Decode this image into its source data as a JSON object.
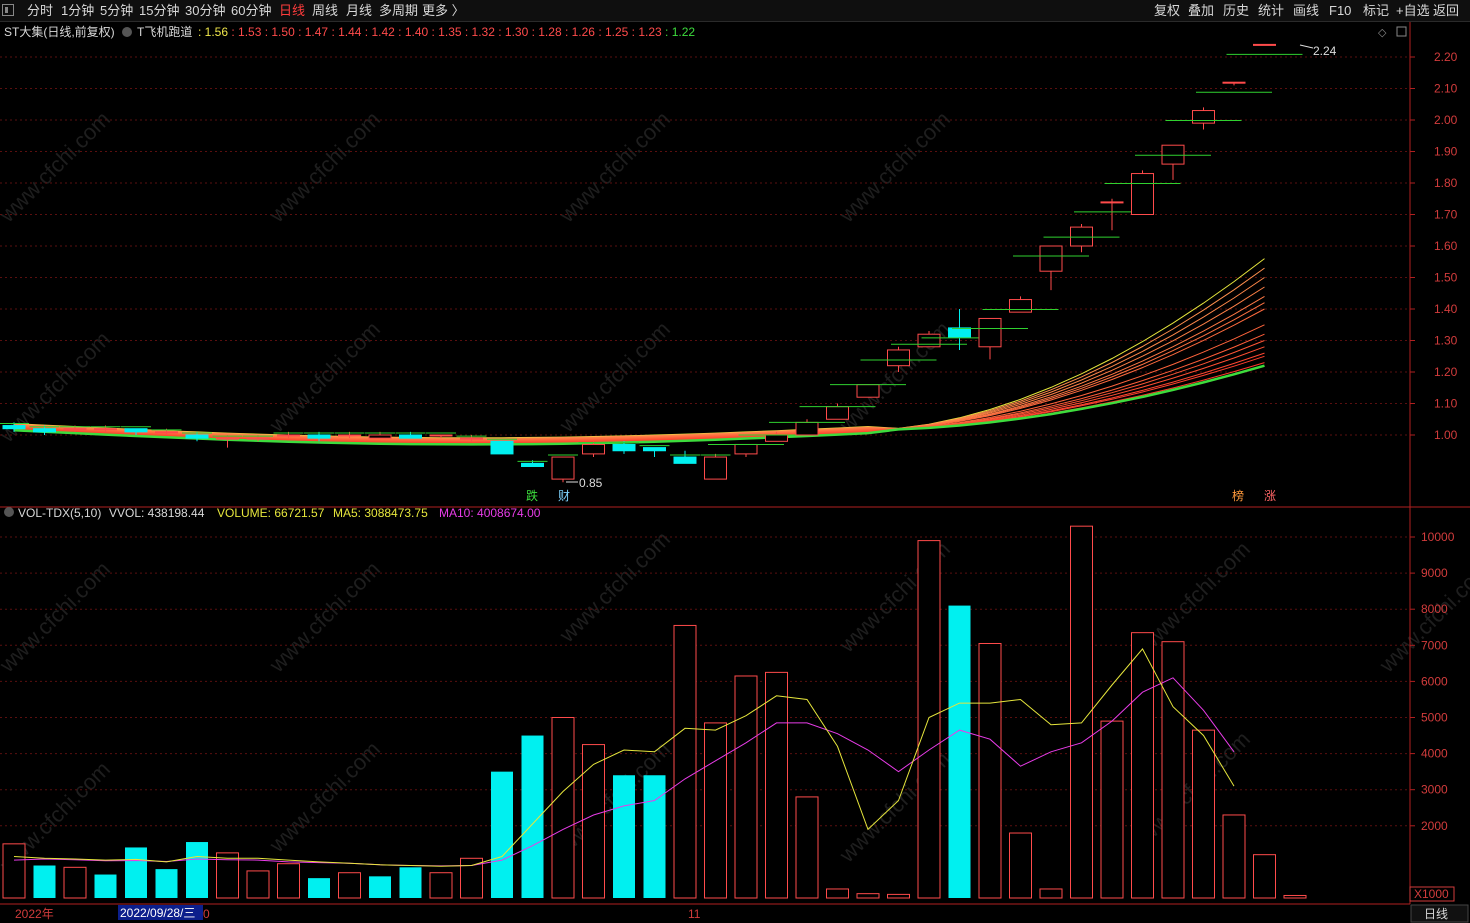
{
  "toolbar": {
    "periods": [
      "分时",
      "1分钟",
      "5分钟",
      "15分钟",
      "30分钟",
      "60分钟",
      "日线",
      "周线",
      "月线",
      "多周期",
      "更多 〉"
    ],
    "active_period": "日线",
    "right_buttons": [
      "复权",
      "叠加",
      "历史",
      "统计",
      "画线",
      "F10",
      "标记",
      "+自选",
      "返回"
    ]
  },
  "main_panel": {
    "title": "ST大集(日线,前复权)",
    "indicator_name": "T飞机跑道",
    "indicator_values": [
      {
        "text": ": 1.56",
        "color": "#f0e64a"
      },
      {
        "text": ": 1.53",
        "color": "#ff4b4b"
      },
      {
        "text": ": 1.50",
        "color": "#ff4b4b"
      },
      {
        "text": ": 1.47",
        "color": "#ff4b4b"
      },
      {
        "text": ": 1.44",
        "color": "#ff4b4b"
      },
      {
        "text": ": 1.42",
        "color": "#ff4b4b"
      },
      {
        "text": ": 1.40",
        "color": "#ff4b4b"
      },
      {
        "text": ": 1.35",
        "color": "#ff4b4b"
      },
      {
        "text": ": 1.32",
        "color": "#ff4b4b"
      },
      {
        "text": ": 1.30",
        "color": "#ff4b4b"
      },
      {
        "text": ": 1.28",
        "color": "#ff4b4b"
      },
      {
        "text": ": 1.26",
        "color": "#ff4b4b"
      },
      {
        "text": ": 1.25",
        "color": "#ff4b4b"
      },
      {
        "text": ": 1.23",
        "color": "#ff4b4b"
      },
      {
        "text": ": 1.22",
        "color": "#3ddc3d"
      }
    ],
    "y_ticks": [
      "2.20",
      "2.10",
      "2.00",
      "1.90",
      "1.80",
      "1.70",
      "1.60",
      "1.50",
      "1.40",
      "1.30",
      "1.20",
      "1.10",
      "1.00"
    ],
    "high_label": "2.24",
    "low_label": "0.85",
    "badges": [
      {
        "text": "跌",
        "color": "#3ddc3d"
      },
      {
        "text": "财",
        "color": "#7fd4ff"
      },
      {
        "text": "榜",
        "color": "#ff9a3c"
      },
      {
        "text": "涨",
        "color": "#ff6666"
      }
    ]
  },
  "volume_panel": {
    "title": "VOL-TDX(5,10)",
    "vvol": "VVOL: 438198.44",
    "volume": "VOLUME: 66721.57",
    "ma5": "MA5: 3088473.75",
    "ma10": "MA10: 4008674.00",
    "y_ticks": [
      "10000",
      "9000",
      "8000",
      "7000",
      "6000",
      "5000",
      "4000",
      "3000",
      "2000"
    ],
    "unit": "X1000"
  },
  "bottom_bar": {
    "year_label": "2022年",
    "cursor_date": "2022/09/28/三",
    "cursor_suffix": "0",
    "month_label": "11",
    "period_label": "日线"
  },
  "watermark": "www.cfchi.com",
  "colors": {
    "up": "#ff4b4b",
    "down": "#00f0f0",
    "ma5": "#e6e63c",
    "ma10": "#e83ce8",
    "grid": "#5a0f0f",
    "axis_text": "#d23c3c"
  },
  "chart_data": {
    "type": "candlestick",
    "price_range": [
      0.85,
      2.24
    ],
    "candles": [
      {
        "o": 1.03,
        "c": 1.02,
        "h": 1.04,
        "l": 1.01
      },
      {
        "o": 1.02,
        "c": 1.01,
        "h": 1.03,
        "l": 1.0
      },
      {
        "o": 1.02,
        "c": 1.02,
        "h": 1.03,
        "l": 1.01
      },
      {
        "o": 1.02,
        "c": 1.02,
        "h": 1.03,
        "l": 1.01
      },
      {
        "o": 1.02,
        "c": 1.01,
        "h": 1.02,
        "l": 1.0
      },
      {
        "o": 1.01,
        "c": 1.01,
        "h": 1.02,
        "l": 1.0
      },
      {
        "o": 1.0,
        "c": 0.99,
        "h": 1.01,
        "l": 0.98
      },
      {
        "o": 0.99,
        "c": 0.99,
        "h": 1.0,
        "l": 0.96
      },
      {
        "o": 0.99,
        "c": 0.99,
        "h": 1.0,
        "l": 0.98
      },
      {
        "o": 1.0,
        "c": 1.0,
        "h": 1.01,
        "l": 0.99
      },
      {
        "o": 1.0,
        "c": 0.99,
        "h": 1.01,
        "l": 0.98
      },
      {
        "o": 1.0,
        "c": 1.0,
        "h": 1.01,
        "l": 0.99
      },
      {
        "o": 0.99,
        "c": 1.0,
        "h": 1.01,
        "l": 0.99
      },
      {
        "o": 1.0,
        "c": 0.99,
        "h": 1.01,
        "l": 0.99
      },
      {
        "o": 1.0,
        "c": 1.0,
        "h": 1.0,
        "l": 0.99
      },
      {
        "o": 0.99,
        "c": 0.99,
        "h": 1.0,
        "l": 0.98
      },
      {
        "o": 0.98,
        "c": 0.94,
        "h": 0.98,
        "l": 0.94
      },
      {
        "o": 0.91,
        "c": 0.9,
        "h": 0.92,
        "l": 0.9
      },
      {
        "o": 0.86,
        "c": 0.93,
        "h": 0.93,
        "l": 0.85
      },
      {
        "o": 0.94,
        "c": 0.97,
        "h": 0.98,
        "l": 0.93
      },
      {
        "o": 0.97,
        "c": 0.95,
        "h": 0.98,
        "l": 0.94
      },
      {
        "o": 0.96,
        "c": 0.95,
        "h": 0.96,
        "l": 0.93
      },
      {
        "o": 0.93,
        "c": 0.91,
        "h": 0.95,
        "l": 0.91
      },
      {
        "o": 0.86,
        "c": 0.93,
        "h": 0.94,
        "l": 0.86
      },
      {
        "o": 0.94,
        "c": 0.97,
        "h": 0.97,
        "l": 0.93
      },
      {
        "o": 0.98,
        "c": 1.0,
        "h": 1.01,
        "l": 0.98
      },
      {
        "o": 1.0,
        "c": 1.04,
        "h": 1.05,
        "l": 1.0
      },
      {
        "o": 1.05,
        "c": 1.09,
        "h": 1.1,
        "l": 1.05
      },
      {
        "o": 1.12,
        "c": 1.16,
        "h": 1.16,
        "l": 1.12
      },
      {
        "o": 1.22,
        "c": 1.27,
        "h": 1.28,
        "l": 1.2
      },
      {
        "o": 1.28,
        "c": 1.32,
        "h": 1.33,
        "l": 1.28
      },
      {
        "o": 1.34,
        "c": 1.31,
        "h": 1.4,
        "l": 1.27
      },
      {
        "o": 1.28,
        "c": 1.37,
        "h": 1.37,
        "l": 1.24
      },
      {
        "o": 1.39,
        "c": 1.43,
        "h": 1.44,
        "l": 1.39
      },
      {
        "o": 1.52,
        "c": 1.6,
        "h": 1.6,
        "l": 1.46
      },
      {
        "o": 1.6,
        "c": 1.66,
        "h": 1.67,
        "l": 1.58
      },
      {
        "o": 1.74,
        "c": 1.74,
        "h": 1.75,
        "l": 1.65
      },
      {
        "o": 1.7,
        "c": 1.83,
        "h": 1.84,
        "l": 1.7
      },
      {
        "o": 1.86,
        "c": 1.92,
        "h": 1.92,
        "l": 1.81
      },
      {
        "o": 1.99,
        "c": 2.03,
        "h": 2.04,
        "l": 1.97
      },
      {
        "o": 2.12,
        "c": 2.12,
        "h": 2.12,
        "l": 2.11
      },
      {
        "o": 2.24,
        "c": 2.24,
        "h": 2.24,
        "l": 2.24
      }
    ],
    "runway_lines_end": [
      1.56,
      1.53,
      1.5,
      1.47,
      1.44,
      1.42,
      1.4,
      1.35,
      1.32,
      1.3,
      1.28,
      1.26,
      1.25,
      1.23,
      1.22
    ],
    "volume_unit": "X1000",
    "volume_range": [
      0,
      10500
    ],
    "volume": [
      {
        "v": 1500,
        "up": true
      },
      {
        "v": 900,
        "up": false
      },
      {
        "v": 850,
        "up": true
      },
      {
        "v": 650,
        "up": false
      },
      {
        "v": 1400,
        "up": false
      },
      {
        "v": 800,
        "up": false
      },
      {
        "v": 1550,
        "up": false
      },
      {
        "v": 1250,
        "up": true
      },
      {
        "v": 750,
        "up": true
      },
      {
        "v": 950,
        "up": true
      },
      {
        "v": 550,
        "up": false
      },
      {
        "v": 700,
        "up": true
      },
      {
        "v": 600,
        "up": false
      },
      {
        "v": 850,
        "up": false
      },
      {
        "v": 700,
        "up": true
      },
      {
        "v": 1100,
        "up": true
      },
      {
        "v": 3500,
        "up": false
      },
      {
        "v": 4500,
        "up": false
      },
      {
        "v": 5000,
        "up": true
      },
      {
        "v": 4250,
        "up": true
      },
      {
        "v": 3400,
        "up": false
      },
      {
        "v": 3400,
        "up": false
      },
      {
        "v": 7550,
        "up": true
      },
      {
        "v": 4850,
        "up": true
      },
      {
        "v": 6150,
        "up": true
      },
      {
        "v": 6250,
        "up": true
      },
      {
        "v": 2800,
        "up": true
      },
      {
        "v": 250,
        "up": true
      },
      {
        "v": 120,
        "up": true
      },
      {
        "v": 100,
        "up": true
      },
      {
        "v": 9900,
        "up": true
      },
      {
        "v": 8100,
        "up": false
      },
      {
        "v": 7050,
        "up": true
      },
      {
        "v": 1800,
        "up": true
      },
      {
        "v": 250,
        "up": true
      },
      {
        "v": 10300,
        "up": true
      },
      {
        "v": 4900,
        "up": true
      },
      {
        "v": 7350,
        "up": true
      },
      {
        "v": 7100,
        "up": true
      },
      {
        "v": 4650,
        "up": true
      },
      {
        "v": 2300,
        "up": true
      },
      {
        "v": 1200,
        "up": true
      },
      {
        "v": 70,
        "up": true
      }
    ],
    "ma5": [
      1150,
      1100,
      1080,
      1050,
      1070,
      1000,
      1150,
      1100,
      1100,
      1050,
      1000,
      960,
      920,
      900,
      880,
      900,
      1150,
      2050,
      2950,
      3700,
      4100,
      4050,
      4700,
      4650,
      5050,
      5600,
      5500,
      4200,
      1900,
      2700,
      5000,
      5400,
      5400,
      5500,
      4800,
      4850,
      5900,
      6900,
      5300,
      4500,
      3100
    ],
    "ma10": [
      1050,
      1080,
      1060,
      1030,
      1040,
      1010,
      1080,
      1060,
      1050,
      1000,
      980,
      960,
      920,
      900,
      890,
      900,
      1050,
      1450,
      1900,
      2300,
      2550,
      2700,
      3300,
      3800,
      4300,
      4850,
      4850,
      4550,
      4100,
      3500,
      4100,
      4650,
      4400,
      3650,
      4050,
      4300,
      4900,
      5700,
      6100,
      5200,
      4050
    ]
  }
}
